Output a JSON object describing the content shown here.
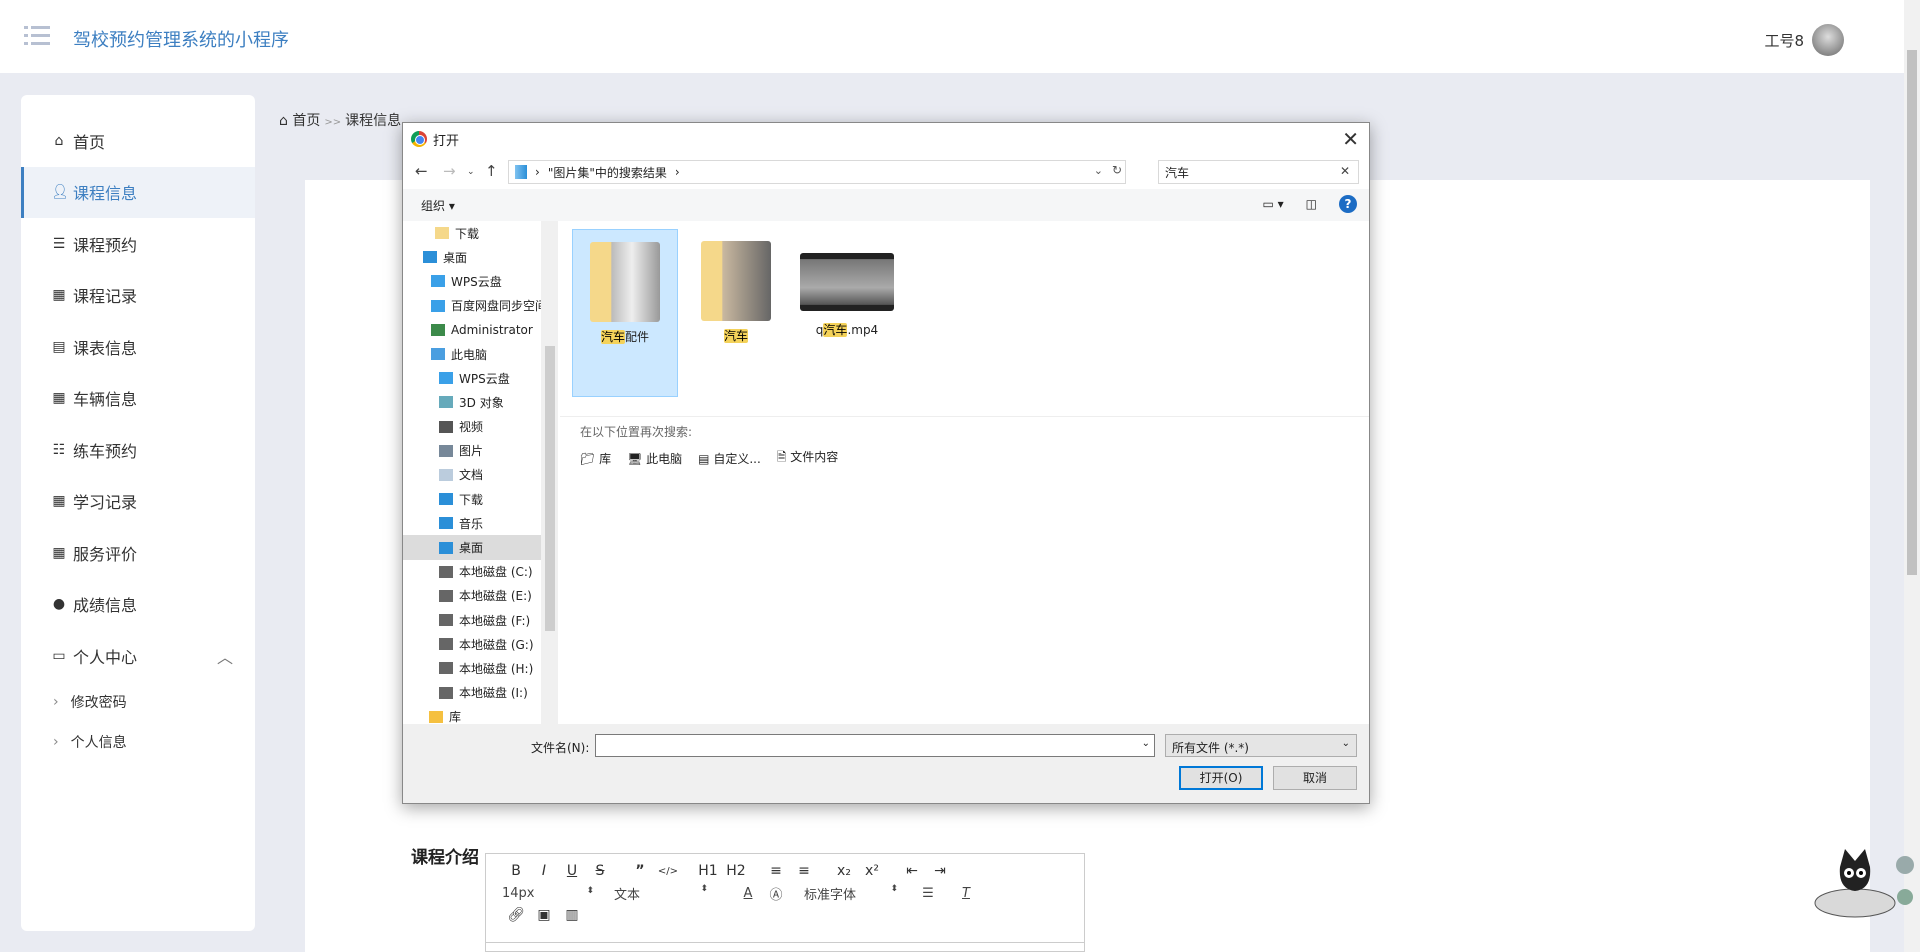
{
  "header": {
    "title": "驾校预约管理系统的小程序",
    "user": "工号8"
  },
  "sidebar": {
    "items": [
      {
        "label": "首页",
        "icon": "home-icon"
      },
      {
        "label": "课程信息",
        "icon": "user-icon"
      },
      {
        "label": "课程预约",
        "icon": "list-icon"
      },
      {
        "label": "课程记录",
        "icon": "grid-icon"
      },
      {
        "label": "课表信息",
        "icon": "clipboard-icon"
      },
      {
        "label": "车辆信息",
        "icon": "grid-icon"
      },
      {
        "label": "练车预约",
        "icon": "sliders-icon"
      },
      {
        "label": "学习记录",
        "icon": "grid-icon"
      },
      {
        "label": "服务评价",
        "icon": "grid-icon"
      },
      {
        "label": "成绩信息",
        "icon": "bulb-icon"
      },
      {
        "label": "个人中心",
        "icon": "wallet-icon"
      }
    ],
    "sub_items": [
      {
        "label": "修改密码"
      },
      {
        "label": "个人信息"
      }
    ]
  },
  "breadcrumb": {
    "home": "首页",
    "sep": ">>",
    "current": "课程信息"
  },
  "form": {
    "intro_label": "课程介绍"
  },
  "editor": {
    "toolbar_row1": [
      "B",
      "I",
      "U",
      "S",
      "”",
      "</>",
      "H1",
      "H2",
      "≡",
      "≡",
      "x₂",
      "x²",
      "⇤",
      "⇥"
    ],
    "font_size": "14px",
    "block_type": "文本",
    "font_family": "标准字体"
  },
  "dialog": {
    "title": "打开",
    "address": "\"图片集\"中的搜索结果",
    "search_value": "汽车",
    "organize": "组织",
    "nav_items": [
      "下载",
      "桌面",
      "WPS云盘",
      "百度网盘同步空间",
      "Administrator",
      "此电脑",
      "WPS云盘",
      "3D 对象",
      "视频",
      "图片",
      "文档",
      "下载",
      "音乐",
      "桌面",
      "本地磁盘 (C:)",
      "本地磁盘 (E:)",
      "本地磁盘 (F:)",
      "本地磁盘 (G:)",
      "本地磁盘 (H:)",
      "本地磁盘 (I:)",
      "库"
    ],
    "files": [
      {
        "highlight": "汽车",
        "rest": "配件"
      },
      {
        "highlight": "汽车",
        "rest": ""
      },
      {
        "prefix": "q",
        "highlight": "汽车",
        "rest": ".mp4"
      }
    ],
    "research_label": "在以下位置再次搜索:",
    "research_links": [
      "库",
      "此电脑",
      "自定义...",
      "文件内容"
    ],
    "filename_label": "文件名(N):",
    "filename_value": "",
    "filetype": "所有文件 (*.*)",
    "open_button": "打开(O)",
    "cancel_button": "取消"
  }
}
